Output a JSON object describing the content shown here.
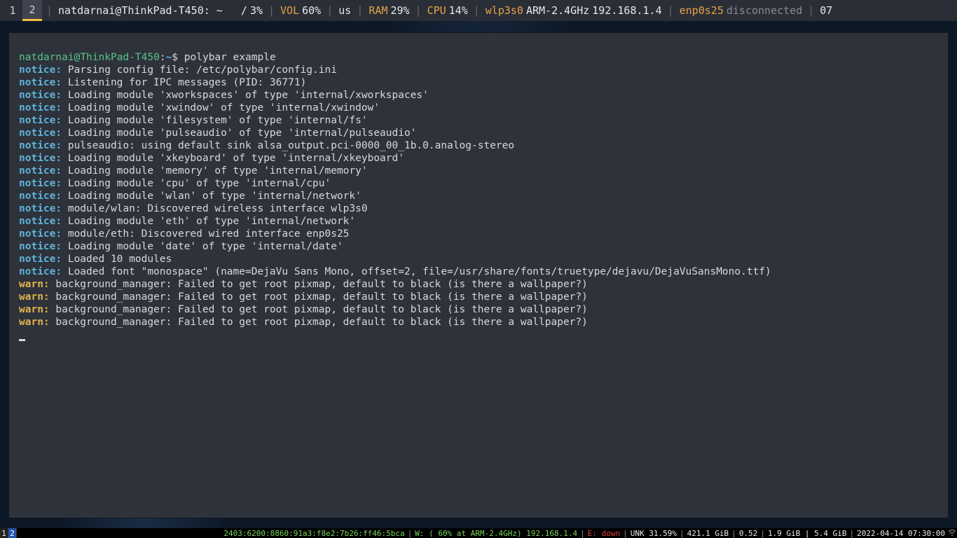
{
  "topbar": {
    "workspaces": [
      {
        "label": "1",
        "active": false
      },
      {
        "label": "2",
        "active": true
      }
    ],
    "window_title": "natdarnai@ThinkPad-T450: ~",
    "fs": {
      "mount": "/",
      "percent": "3%"
    },
    "vol": {
      "label": "VOL",
      "value": "60%"
    },
    "keyboard": "us",
    "ram": {
      "label": "RAM",
      "value": "29%"
    },
    "cpu": {
      "label": "CPU",
      "value": "14%"
    },
    "wlan": {
      "iface": "wlp3s0",
      "essid": "ARM-2.4GHz",
      "ip": "192.168.1.4"
    },
    "eth": {
      "iface": "enp0s25",
      "status": "disconnected"
    },
    "date_trunc": "07"
  },
  "terminal": {
    "prompt": {
      "user": "natdarnai",
      "host": "ThinkPad-T450",
      "path": "~",
      "symbol": "$"
    },
    "command": "polybar example",
    "lines": [
      {
        "tag": "notice:",
        "kind": "notice",
        "text": " Parsing config file: /etc/polybar/config.ini"
      },
      {
        "tag": "notice:",
        "kind": "notice",
        "text": " Listening for IPC messages (PID: 36771)"
      },
      {
        "tag": "notice:",
        "kind": "notice",
        "text": " Loading module 'xworkspaces' of type 'internal/xworkspaces'"
      },
      {
        "tag": "notice:",
        "kind": "notice",
        "text": " Loading module 'xwindow' of type 'internal/xwindow'"
      },
      {
        "tag": "notice:",
        "kind": "notice",
        "text": " Loading module 'filesystem' of type 'internal/fs'"
      },
      {
        "tag": "notice:",
        "kind": "notice",
        "text": " Loading module 'pulseaudio' of type 'internal/pulseaudio'"
      },
      {
        "tag": "notice:",
        "kind": "notice",
        "text": " pulseaudio: using default sink alsa_output.pci-0000_00_1b.0.analog-stereo"
      },
      {
        "tag": "notice:",
        "kind": "notice",
        "text": " Loading module 'xkeyboard' of type 'internal/xkeyboard'"
      },
      {
        "tag": "notice:",
        "kind": "notice",
        "text": " Loading module 'memory' of type 'internal/memory'"
      },
      {
        "tag": "notice:",
        "kind": "notice",
        "text": " Loading module 'cpu' of type 'internal/cpu'"
      },
      {
        "tag": "notice:",
        "kind": "notice",
        "text": " Loading module 'wlan' of type 'internal/network'"
      },
      {
        "tag": "notice:",
        "kind": "notice",
        "text": " module/wlan: Discovered wireless interface wlp3s0"
      },
      {
        "tag": "notice:",
        "kind": "notice",
        "text": " Loading module 'eth' of type 'internal/network'"
      },
      {
        "tag": "notice:",
        "kind": "notice",
        "text": " module/eth: Discovered wired interface enp0s25"
      },
      {
        "tag": "notice:",
        "kind": "notice",
        "text": " Loading module 'date' of type 'internal/date'"
      },
      {
        "tag": "notice:",
        "kind": "notice",
        "text": " Loaded 10 modules"
      },
      {
        "tag": "notice:",
        "kind": "notice",
        "text": " Loaded font \"monospace\" (name=DejaVu Sans Mono, offset=2, file=/usr/share/fonts/truetype/dejavu/DejaVuSansMono.ttf)"
      },
      {
        "tag": "warn:",
        "kind": "warn",
        "text": " background_manager: Failed to get root pixmap, default to black (is there a wallpaper?)"
      },
      {
        "tag": "warn:",
        "kind": "warn",
        "text": " background_manager: Failed to get root pixmap, default to black (is there a wallpaper?)"
      },
      {
        "tag": "warn:",
        "kind": "warn",
        "text": " background_manager: Failed to get root pixmap, default to black (is there a wallpaper?)"
      },
      {
        "tag": "warn:",
        "kind": "warn",
        "text": " background_manager: Failed to get root pixmap, default to black (is there a wallpaper?)"
      }
    ]
  },
  "bottombar": {
    "workspaces": [
      {
        "label": "1",
        "active": false
      },
      {
        "label": "2",
        "active": true
      }
    ],
    "ipv6": "2403:6200:8860:91a3:f8e2:7b26:ff46:5bca",
    "wifi": "W: ( 60% at ARM-2.4GHz) 192.168.1.4",
    "eth": {
      "label": "E:",
      "status": "down"
    },
    "unk": "UNK 31.59%",
    "disk": "421.1 GiB",
    "load": "0.52",
    "mem": "1.9 GiB | 5.4 GiB",
    "datetime": "2022-04-14 07:30:00"
  }
}
